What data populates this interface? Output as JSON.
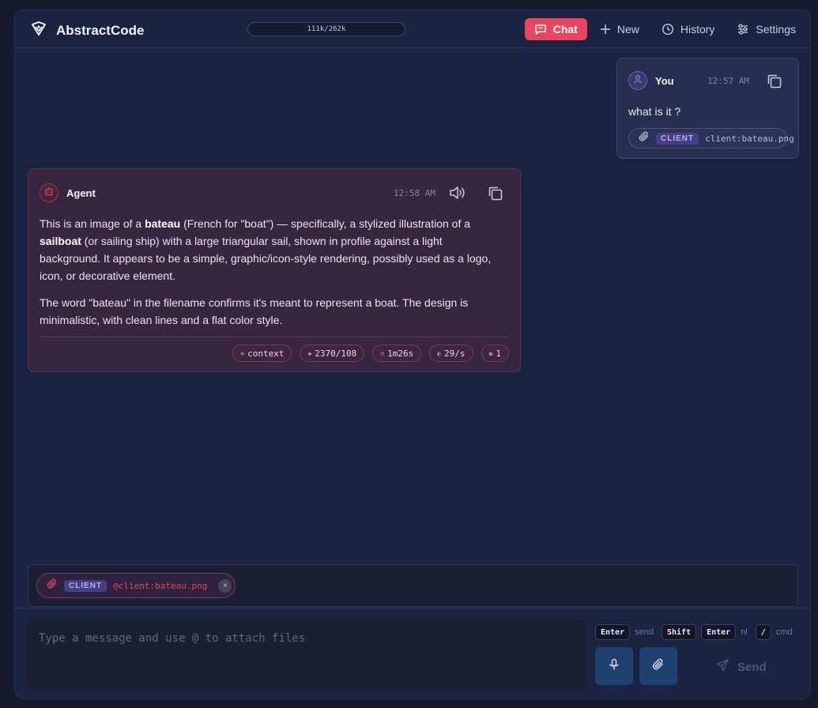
{
  "header": {
    "brand": "AbstractCode",
    "context_usage": "111k/262k",
    "nav": [
      {
        "label": "Chat",
        "icon": "chat-bubble-icon",
        "active": true
      },
      {
        "label": "New",
        "icon": "plus-icon",
        "active": false
      },
      {
        "label": "History",
        "icon": "clock-icon",
        "active": false
      },
      {
        "label": "Settings",
        "icon": "sliders-icon",
        "active": false
      }
    ]
  },
  "messages": {
    "user": {
      "name": "You",
      "time": "12:57 AM",
      "text": "what is it ?",
      "attachment": {
        "tag": "CLIENT",
        "filename": "client:bateau.png"
      }
    },
    "agent": {
      "name": "Agent",
      "time": "12:58 AM",
      "para1_a": "This is an image of a ",
      "para1_b": "bateau",
      "para1_c": " (French for \"boat\") — specifically, a stylized illustration of a ",
      "para1_d": "sailboat",
      "para1_e": " (or sailing ship) with a large triangular sail, shown in profile against a light background. It appears to be a simple, graphic/icon-style rendering, possibly used as a logo, icon, or decorative element.",
      "para2": "The word \"bateau\" in the filename confirms it's meant to represent a boat. The design is minimalistic, with clean lines and a flat color style.",
      "stats": {
        "context": "context",
        "tokens": "2370/108",
        "duration": "1m26s",
        "rate": "29/s",
        "count": "1"
      }
    }
  },
  "pending_attachment": {
    "tag": "CLIENT",
    "filename": "@client:bateau.png",
    "remove": "×"
  },
  "composer": {
    "placeholder": "Type a message and use @ to attach files",
    "hints": {
      "enter": "Enter",
      "send": "send",
      "shift": "Shift",
      "enter2": "Enter",
      "nl": "nl",
      "slash": "/",
      "cmd": "cmd"
    },
    "send_label": "Send"
  },
  "colors": {
    "accent": "#e8465f",
    "background": "#1a2340",
    "agent_bubble": "#36263f",
    "user_bubble": "#262f50",
    "tag": "#463f86"
  }
}
